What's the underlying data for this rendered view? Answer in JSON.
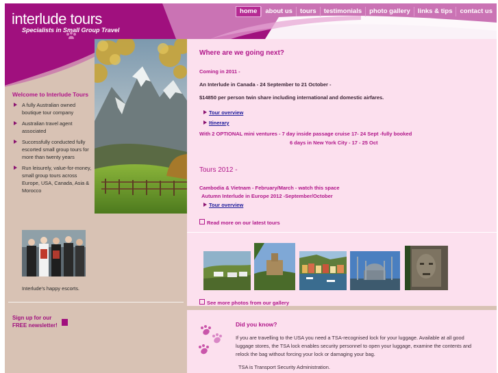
{
  "header": {
    "logo_title": "interlude tours",
    "logo_subtitle": "Specialists in Small Group Travel",
    "nav": [
      "home",
      "about us",
      "tours",
      "testimonials",
      "photo gallery",
      "links & tips",
      "contact us"
    ]
  },
  "sidebar": {
    "welcome_title": "Welcome to Interlude Tours",
    "items": [
      "A fully Australian owned boutique tour company",
      "Australian travel agent associated",
      "Successfully conducted fully escorted small group tours for more than twenty years",
      "Run leisurely, value-for-money, small group tours across Europe, USA, Canada, Asia & Morocco"
    ],
    "escort_caption": "Interlude's happy escorts.",
    "newsletter": "Sign up for our FREE newsletter!"
  },
  "main": {
    "heading": "Where are we going next?",
    "coming": "Coming in 2011 -",
    "canada": "An Interlude in Canada - 24 September to 21 October -",
    "price": "$14850 per person twin share including international and domestic airfares.",
    "tour_overview_1": "Tour overview",
    "itinerary": "Itinerary",
    "optional_1": "With 2 OPTIONAL mini ventures - 7 day inside passage cruise 17- 24 Sept -fully booked",
    "optional_2": "6 days in New York City - 17 - 25 Oct",
    "tours2012": "Tours 2012 -",
    "cambodia": "Cambodia & Vietnam - February/March - watch this space",
    "autumn": "Autumn Interlude in Europe 2012 -September/October",
    "tour_overview_2": "Tour overview",
    "read_more": "Read more on our latest tours",
    "gallery_more": "See more photos from our gallery"
  },
  "did_you_know": {
    "title": "Did you know?",
    "body": "If you are travelling to the USA you need a TSA-recognised lock for your luggage.  Available at all good luggage stores, the TSA lock enables security personnel to open your luggage, examine the contents and relock the bag without forcing your lock or damaging your bag.",
    "footnote": "TSA is Transport Security Administration."
  },
  "colors": {
    "brand": "#a0107e",
    "sidebar": "#d8c2b4",
    "main_bg": "#fce0ee",
    "link": "#1a1a9a"
  }
}
